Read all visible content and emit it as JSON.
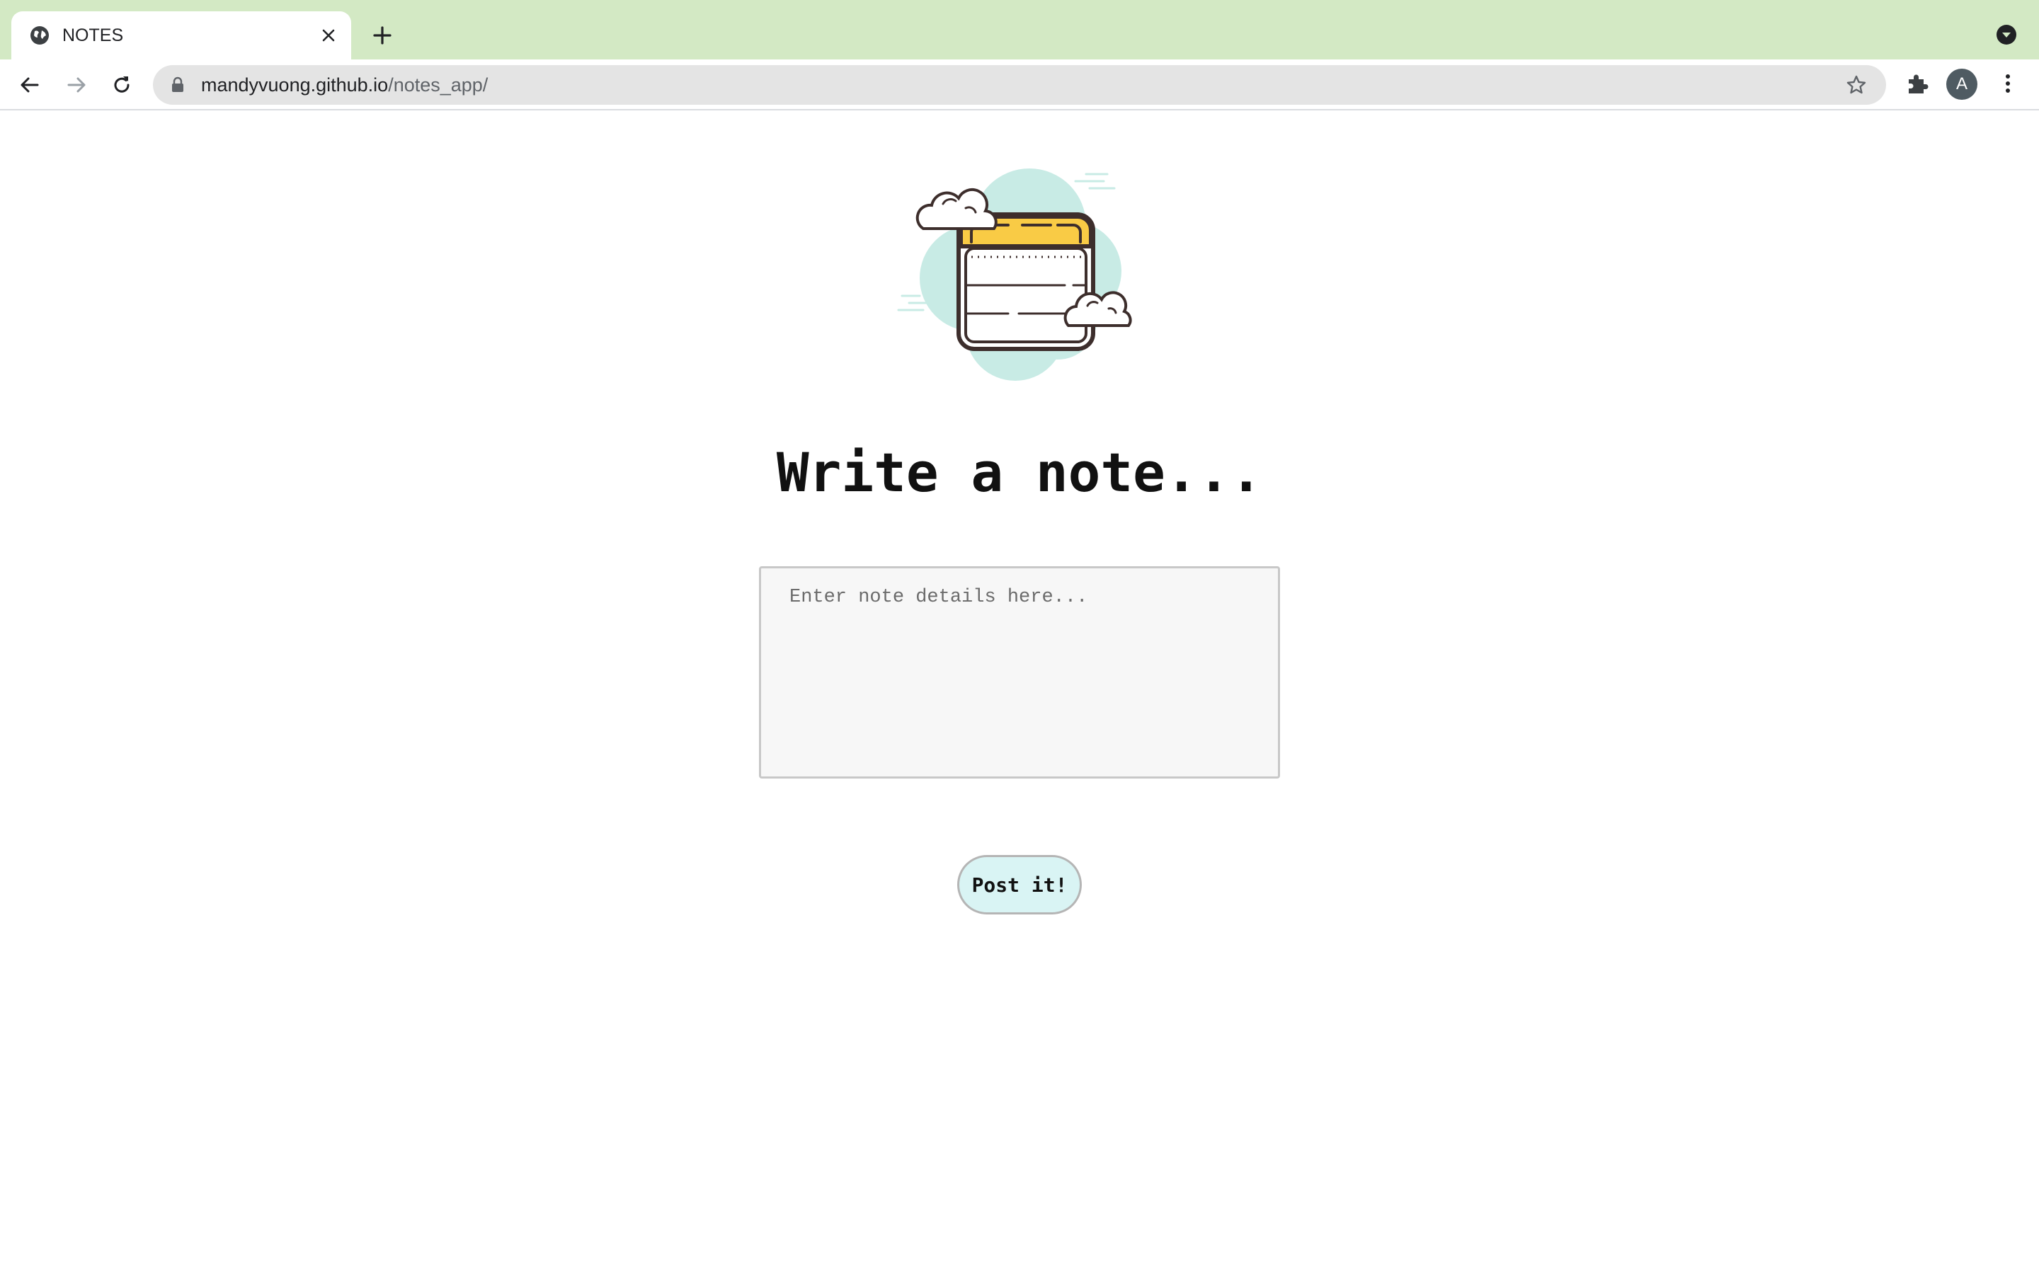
{
  "browser": {
    "tab": {
      "title": "NOTES"
    },
    "address_bar": {
      "domain": "mandyvuong.github.io",
      "path": "/notes_app/"
    },
    "profile_initial": "A",
    "colors": {
      "tabstrip": "#d3e9c4",
      "omnibox": "#e4e4e4",
      "avatar": "#4f5b62"
    }
  },
  "page": {
    "heading": "Write a note...",
    "note_input": {
      "placeholder": "Enter note details here...",
      "value": ""
    },
    "post_button_label": "Post it!",
    "colors": {
      "button_bg": "#d9f4f4",
      "note_header": "#f9cb45",
      "cloud_bg": "#c8ebe5"
    }
  },
  "icons": {
    "tab_favicon": "globe-icon",
    "tab_close": "close-icon",
    "new_tab": "plus-icon",
    "tab_search": "chevron-down-circle-icon",
    "back": "back-arrow-icon",
    "forward": "forward-arrow-icon",
    "reload": "reload-icon",
    "lock": "lock-icon",
    "bookmark": "star-icon",
    "extensions": "puzzle-icon",
    "menu": "kebab-menu-icon",
    "illustration": "notepad-with-clouds-icon"
  }
}
